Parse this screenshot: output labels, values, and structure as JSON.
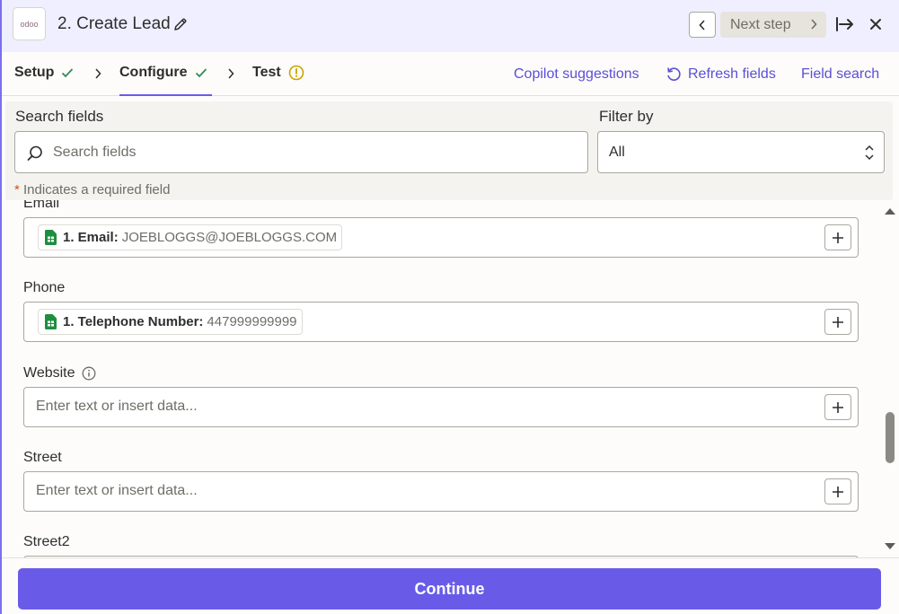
{
  "header": {
    "app_logo_text": "odoo",
    "step_title": "2. Create Lead",
    "next_step_label": "Next step"
  },
  "tabs": [
    {
      "label": "Setup",
      "status": "complete"
    },
    {
      "label": "Configure",
      "status": "complete"
    },
    {
      "label": "Test",
      "status": "warning"
    }
  ],
  "links": {
    "copilot": "Copilot suggestions",
    "refresh": "Refresh fields",
    "field_search": "Field search"
  },
  "search_panel": {
    "search_label": "Search fields",
    "search_placeholder": "Search fields",
    "filter_label": "Filter by",
    "filter_value": "All",
    "required_star": "*",
    "required_note": "Indicates a required field"
  },
  "fields": {
    "email": {
      "label": "Email",
      "chip_name": "1. Email:",
      "chip_value": "JOEBLOGGS@JOEBLOGGS.COM"
    },
    "phone": {
      "label": "Phone",
      "chip_name": "1. Telephone Number:",
      "chip_value": "447999999999"
    },
    "website": {
      "label": "Website",
      "placeholder": "Enter text or insert data..."
    },
    "street": {
      "label": "Street",
      "placeholder": "Enter text or insert data..."
    },
    "street2": {
      "label": "Street2"
    }
  },
  "footer": {
    "continue_label": "Continue"
  },
  "colors": {
    "accent": "#695be8",
    "link": "#5b4fd6",
    "success": "#2e8b57",
    "warning": "#c9a400",
    "sheets_green": "#1e8e3e"
  }
}
